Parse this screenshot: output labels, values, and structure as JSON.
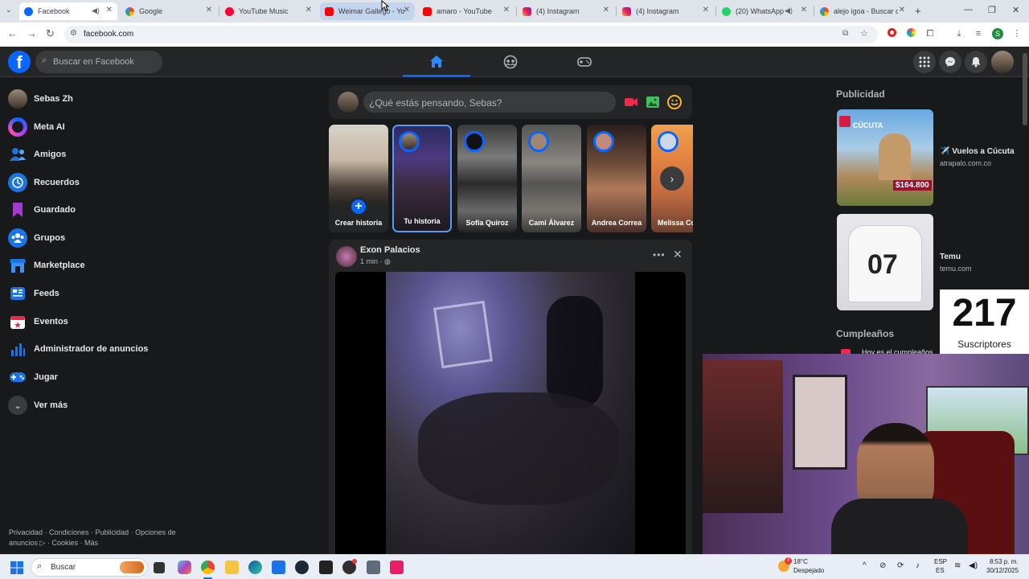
{
  "browser": {
    "tabs": [
      {
        "title": "Facebook",
        "active": true,
        "audio": true
      },
      {
        "title": "Google"
      },
      {
        "title": "YouTube Music"
      },
      {
        "title": "Weimar Gallego - Yo",
        "hovered": true
      },
      {
        "title": "amaro - YouTube"
      },
      {
        "title": "(4) Instagram"
      },
      {
        "title": "(4) Instagram"
      },
      {
        "title": "(20) WhatsApp",
        "audio": true
      },
      {
        "title": "alejo igoa - Buscar co"
      }
    ],
    "url": "facebook.com",
    "profile_initial": "S"
  },
  "facebook": {
    "search_placeholder": "Buscar en Facebook",
    "sidebar": [
      {
        "label": "Sebas Zh",
        "icon": "profile-avatar"
      },
      {
        "label": "Meta AI",
        "icon": "meta-ai-icon"
      },
      {
        "label": "Amigos",
        "icon": "friends-icon"
      },
      {
        "label": "Recuerdos",
        "icon": "memories-icon"
      },
      {
        "label": "Guardado",
        "icon": "saved-icon"
      },
      {
        "label": "Grupos",
        "icon": "groups-icon"
      },
      {
        "label": "Marketplace",
        "icon": "marketplace-icon"
      },
      {
        "label": "Feeds",
        "icon": "feeds-icon"
      },
      {
        "label": "Eventos",
        "icon": "events-icon"
      },
      {
        "label": "Administrador de anuncios",
        "icon": "ads-manager-icon"
      },
      {
        "label": "Jugar",
        "icon": "gaming-icon"
      },
      {
        "label": "Ver más",
        "icon": "chevron-down-icon"
      }
    ],
    "footer_line1": "Privacidad · Condiciones · Publicidad · Opciones de",
    "footer_line2": "anuncios ▷ · Cookies · Más",
    "composer_placeholder": "¿Qué estás pensando, Sebas?",
    "stories": [
      {
        "name": "Crear historia"
      },
      {
        "name": "Tu historia"
      },
      {
        "name": "Sofía Quiroz"
      },
      {
        "name": "Cami Álvarez"
      },
      {
        "name": "Andrea Correa"
      },
      {
        "name": "Melissa Cos"
      }
    ],
    "post": {
      "author": "Exon Palacios",
      "time": "1 min · "
    },
    "right": {
      "ads_title": "Publicidad",
      "ads": [
        {
          "name": "✈️ Vuelos a Cúcuta",
          "url": "atrapalo.com.co",
          "image_text": "CÚCUTA",
          "price": "$164.800"
        },
        {
          "name": "Temu",
          "url": "temu.com",
          "image_text": "07"
        }
      ],
      "birthdays_title": "Cumpleaños",
      "birthdays_text": "Hoy es el cumpleaños"
    }
  },
  "overlay": {
    "subscribers_count": "217",
    "subscribers_label": "Suscriptores"
  },
  "taskbar": {
    "search_placeholder": "Buscar",
    "weather_temp": "18°C",
    "weather_desc": "Despejado",
    "weather_badge": "3",
    "lang_top": "ESP",
    "lang_bottom": "ES",
    "time": "8:53 p. m.",
    "date": "30/12/2025"
  }
}
